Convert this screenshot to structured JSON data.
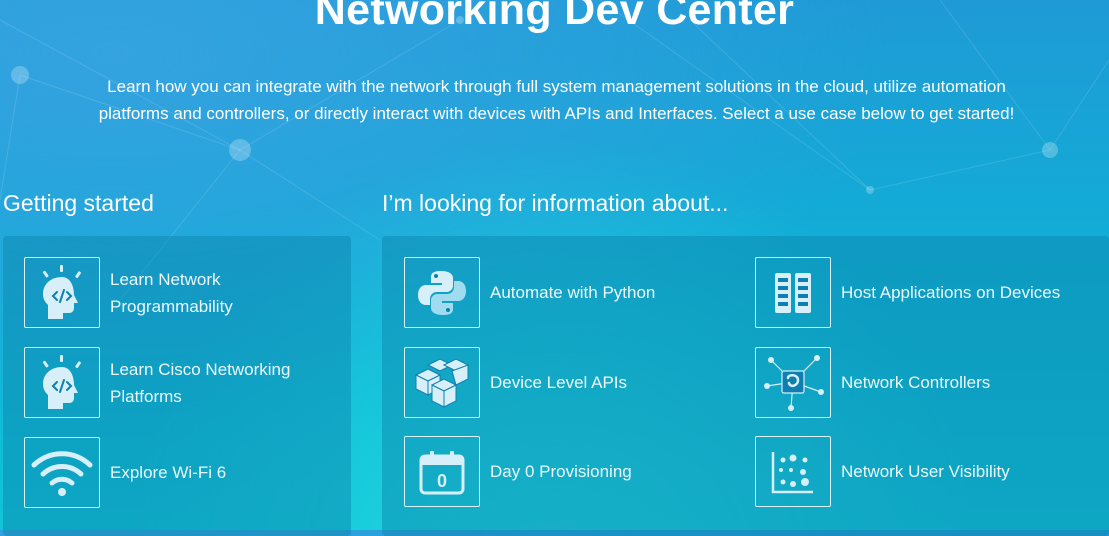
{
  "page": {
    "title": "Networking Dev Center",
    "intro": "Learn how you can integrate with the network through full system management solutions in the cloud, utilize automation platforms and controllers, or directly interact with devices with APIs and Interfaces. Select a use case below to get started!"
  },
  "getting_started": {
    "heading": "Getting started",
    "cards": [
      {
        "label_line1": "Learn Network",
        "label_line2": "Programmability",
        "icon": "head-code-icon"
      },
      {
        "label_line1": "Learn Cisco Networking",
        "label_line2": "Platforms",
        "icon": "head-code-icon"
      },
      {
        "label": "Explore Wi-Fi 6",
        "icon": "wifi-icon"
      }
    ]
  },
  "info": {
    "heading": "I’m looking for information about...",
    "cards": [
      {
        "label": "Automate with Python",
        "icon": "python-icon"
      },
      {
        "label": "Host Applications on Devices",
        "icon": "server-rack-icon"
      },
      {
        "label": "Device Level APIs",
        "icon": "blocks-icon"
      },
      {
        "label": "Network Controllers",
        "icon": "network-hub-icon"
      },
      {
        "label": "Day 0 Provisioning",
        "icon": "calendar-icon",
        "calendar_day": "0"
      },
      {
        "label": "Network User Visibility",
        "icon": "dot-chart-icon"
      }
    ]
  },
  "colors": {
    "background_top": "#1f9ad6",
    "background_bottom": "#10c4d8",
    "icon_fill": "#d6eff8"
  }
}
